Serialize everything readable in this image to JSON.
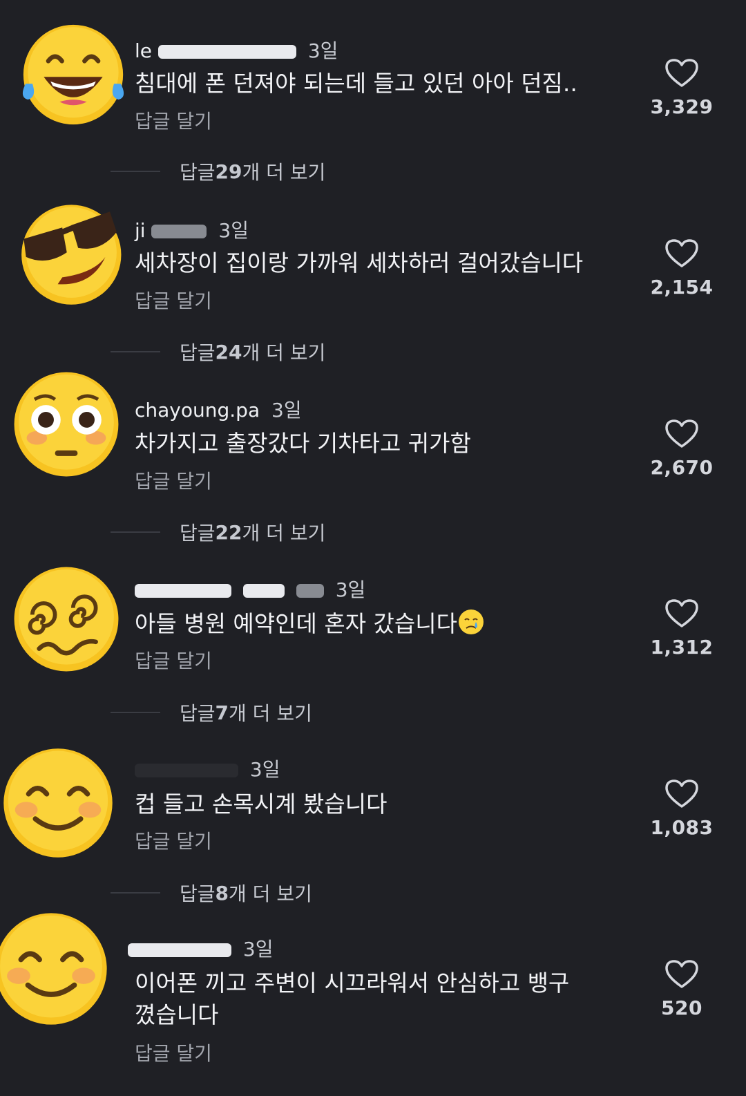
{
  "comments": [
    {
      "user": "le",
      "time": "3일",
      "text": "침대에 폰 던져야 되는데 들고 있던 아아 던짐..",
      "reply": "답글 달기",
      "likes": "3,329",
      "more_prefix": "답글 ",
      "more_num": "29",
      "more_suffix": "개 더 보기",
      "avatar_icon": "face-tears-of-joy-icon"
    },
    {
      "user": "ji",
      "time": "3일",
      "text": "세차장이 집이랑 가까워 세차하러 걸어갔습니다",
      "reply": "답글 달기",
      "likes": "2,154",
      "more_prefix": "답글 ",
      "more_num": "24",
      "more_suffix": "개 더 보기",
      "avatar_icon": "smiling-face-with-sunglasses-icon"
    },
    {
      "user": "chayoung.pa",
      "time": "3일",
      "text": "차가지고 출장갔다 기차타고 귀가함",
      "reply": "답글 달기",
      "likes": "2,670",
      "more_prefix": "답글 ",
      "more_num": "22",
      "more_suffix": "개 더 보기",
      "avatar_icon": "flushed-face-icon"
    },
    {
      "user": "",
      "time": "3일",
      "text": "아들 병원 예약인데 혼자 갔습니다",
      "reply": "답글 달기",
      "likes": "1,312",
      "more_prefix": "답글 ",
      "more_num": "7",
      "more_suffix": "개 더 보기",
      "avatar_icon": "dizzy-face-icon",
      "inline_emoji": "crying-face-icon"
    },
    {
      "user": "",
      "time": "3일",
      "text": "컵 들고 손목시계 봤습니다",
      "reply": "답글 달기",
      "likes": "1,083",
      "more_prefix": "답글 ",
      "more_num": "8",
      "more_suffix": "개 더 보기",
      "avatar_icon": "smiling-face-with-smiling-eyes-icon"
    },
    {
      "user": "",
      "time": "3일",
      "text": "이어폰 끼고 주변이 시끄라워서 안심하고 뱅구 꼈습니다",
      "reply": "답글 달기",
      "likes": "520",
      "avatar_icon": "smiling-face-with-smiling-eyes-icon"
    }
  ]
}
